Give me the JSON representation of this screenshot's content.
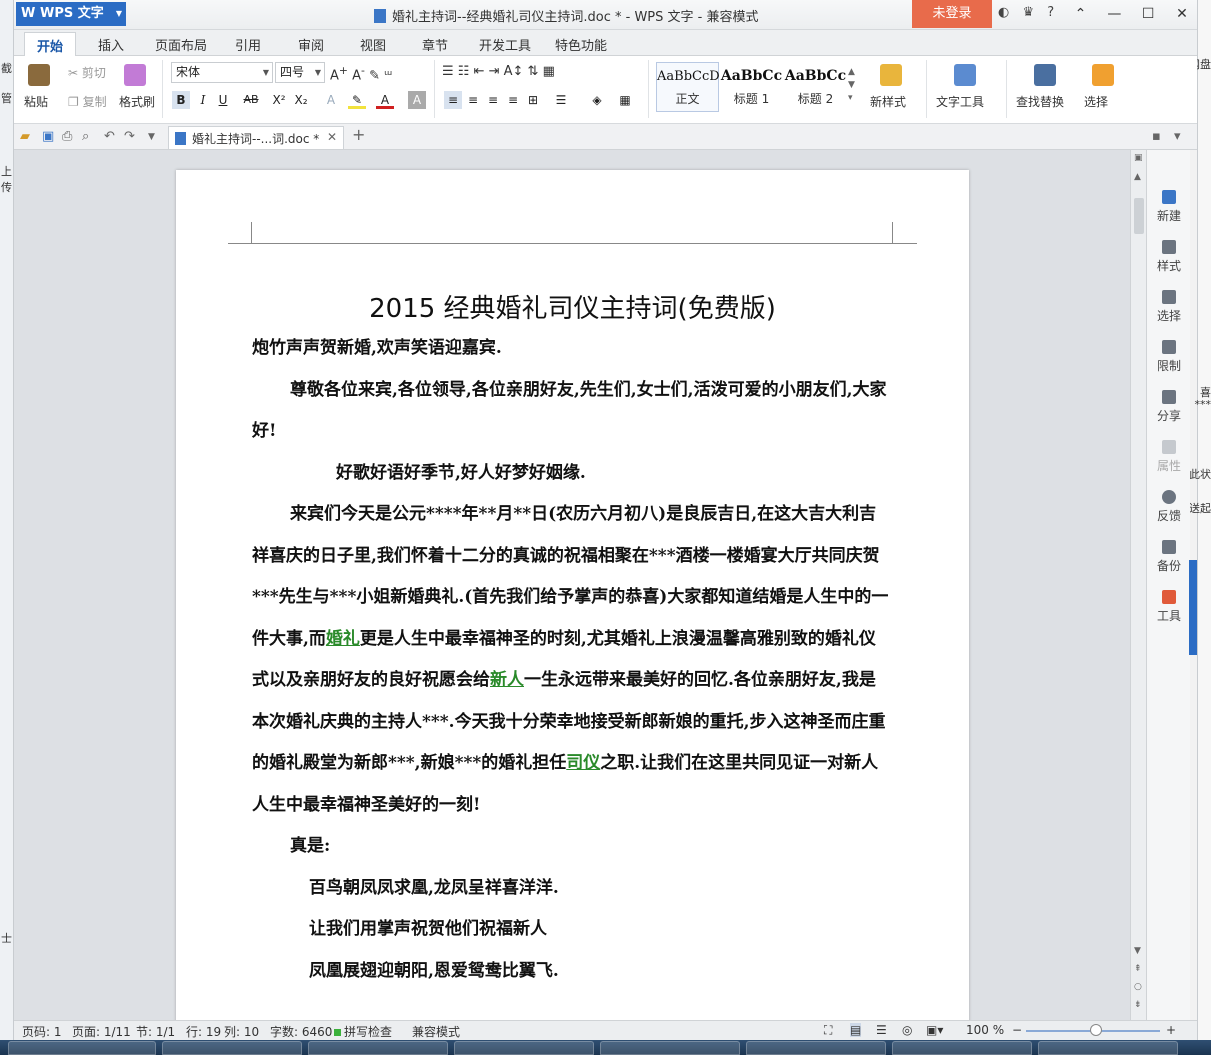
{
  "window": {
    "app_name": "WPS 文字",
    "title": "婚礼主持词--经典婚礼司仪主持词.doc * - WPS 文字 - 兼容模式",
    "login_button": "未登录"
  },
  "background_left_text": [
    "截",
    "管",
    "上传",
    "士"
  ],
  "background_right_text": [
    "网盘",
    "喜",
    "***",
    "此状",
    "送起"
  ],
  "menu_tabs": [
    "开始",
    "插入",
    "页面布局",
    "引用",
    "审阅",
    "视图",
    "章节",
    "开发工具",
    "特色功能"
  ],
  "ribbon": {
    "paste": "粘贴",
    "cut": "剪切",
    "copy": "复制",
    "format_painter": "格式刷",
    "font_name": "宋体",
    "font_size": "四号",
    "styles": [
      {
        "sample": "AaBbCcD",
        "name": "正文"
      },
      {
        "sample": "AaBbCc",
        "name": "标题 1"
      },
      {
        "sample": "AaBbCc",
        "name": "标题 2"
      }
    ],
    "new_style": "新样式",
    "text_tools": "文字工具",
    "find_replace": "查找替换",
    "select": "选择"
  },
  "document_tab": "婚礼主持词--...词.doc *",
  "document": {
    "title": "2015 经典婚礼司仪主持词(免费版)",
    "p1": "炮竹声声贺新婚,欢声笑语迎嘉宾.",
    "p2": "尊敬各位来宾,各位领导,各位亲朋好友,先生们,女士们,活泼可爱的小朋友们,大家好!",
    "p3": "好歌好语好季节,好人好梦好姻缘.",
    "p4_a": "来宾们今天是公元****年**月**日(农历六月初八)是良辰吉日,在这大吉大利吉祥喜庆的日子里,我们怀着十二分的真诚的祝福相聚在***酒楼一楼婚宴大厅共同庆贺***先生与***小姐新婚典礼.(首先我们给予掌声的恭喜)大家都知道结婚是人生中的一件大事,而",
    "p4_link1": "婚礼",
    "p4_b": "更是人生中最幸福神圣的时刻,尤其婚礼上浪漫温馨高雅别致的婚礼仪式以及亲朋好友的良好祝愿会给",
    "p4_link2": "新人",
    "p4_c": "一生永远带来最美好的回忆.各位亲朋好友,我是本次婚礼庆典的主持人***.今天我十分荣幸地接受新郎新娘的重托,步入这神圣而庄重的婚礼殿堂为新郎***,新娘***的婚礼担任",
    "p4_link3": "司仪",
    "p4_d": "之职.让我们在这里共同见证一对新人人生中最幸福神圣美好的一刻!",
    "p5": "真是:",
    "p6": "百鸟朝凤凤求凰,龙凤呈祥喜洋洋.",
    "p7": "让我们用掌声祝贺他们祝福新人",
    "p8": "凤凰展翅迎朝阳,恩爱鸳鸯比翼飞."
  },
  "right_panel": [
    "新建",
    "样式",
    "选择",
    "限制",
    "分享",
    "属性",
    "反馈",
    "备份",
    "工具"
  ],
  "status": {
    "page_num": "页码: 1",
    "pages": "页面: 1/11",
    "section": "节: 1/1",
    "row": "行: 19",
    "col": "列: 10",
    "words": "字数: 6460",
    "spell": "拼写检查",
    "mode": "兼容模式",
    "zoom": "100 %"
  },
  "colors": {
    "accent": "#2b6cc4",
    "login": "#e86b4b",
    "link": "#2a8a2a"
  }
}
